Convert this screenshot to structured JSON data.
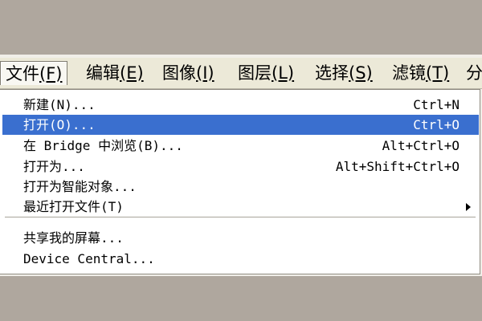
{
  "menubar": {
    "items": [
      {
        "label": "文件",
        "mnemonic": "(F)"
      },
      {
        "label": "编辑",
        "mnemonic": "(E)"
      },
      {
        "label": "图像",
        "mnemonic": "(I)"
      },
      {
        "label": "图层",
        "mnemonic": "(L)"
      },
      {
        "label": "选择",
        "mnemonic": "(S)"
      },
      {
        "label": "滤镜",
        "mnemonic": "(T)"
      },
      {
        "label": "分",
        "mnemonic": ""
      }
    ]
  },
  "file_menu": {
    "items": [
      {
        "label": "新建(N)...",
        "shortcut": "Ctrl+N"
      },
      {
        "label": "打开(O)...",
        "shortcut": "Ctrl+O"
      },
      {
        "label": "在 Bridge 中浏览(B)...",
        "shortcut": "Alt+Ctrl+O"
      },
      {
        "label": "打开为...",
        "shortcut": "Alt+Shift+Ctrl+O"
      },
      {
        "label": "打开为智能对象...",
        "shortcut": ""
      },
      {
        "label": "最近打开文件(T)",
        "shortcut": ""
      },
      {
        "label": "共享我的屏幕...",
        "shortcut": ""
      },
      {
        "label": "Device Central...",
        "shortcut": ""
      }
    ],
    "highlighted": "打开(O)..."
  },
  "colors": {
    "background": "#afa79e",
    "menu_bg": "#ece9d8",
    "highlight": "#3a6fcf"
  }
}
